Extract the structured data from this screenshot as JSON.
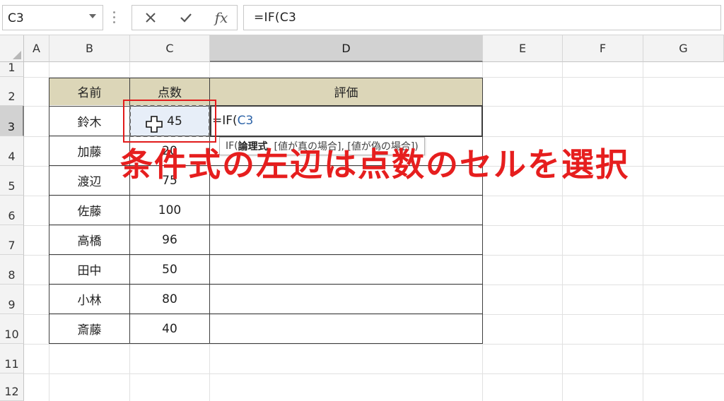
{
  "formula_bar": {
    "name_box": "C3",
    "cancel_icon": "close-icon",
    "enter_icon": "check-icon",
    "fx_label": "fx",
    "formula": "=IF(C3"
  },
  "columns": [
    "A",
    "B",
    "C",
    "D",
    "E",
    "F",
    "G"
  ],
  "active_column": "D",
  "rows": [
    "1",
    "2",
    "3",
    "4",
    "5",
    "6",
    "7",
    "8",
    "9",
    "10",
    "11",
    "12"
  ],
  "active_row": "3",
  "table": {
    "header_name": "名前",
    "header_score": "点数",
    "header_eval": "評価",
    "header_fill_color": "#dcd6b8",
    "records": [
      {
        "name": "鈴木",
        "score": "45"
      },
      {
        "name": "加藤",
        "score": "20"
      },
      {
        "name": "渡辺",
        "score": "75"
      },
      {
        "name": "佐藤",
        "score": "100"
      },
      {
        "name": "高橋",
        "score": "96"
      },
      {
        "name": "田中",
        "score": "50"
      },
      {
        "name": "小林",
        "score": "80"
      },
      {
        "name": "斎藤",
        "score": "40"
      }
    ]
  },
  "editing": {
    "cell_text_prefix": "=IF(",
    "cell_text_ref": "C3",
    "ref_color": "#2e64a8"
  },
  "tooltip": {
    "fn": "IF(",
    "arg1": "論理式",
    "rest": ", [値が真の場合], [値が偽の場合])"
  },
  "annotation": {
    "text": "条件式の左辺は点数のセルを選択",
    "color": "#e61e1e"
  }
}
